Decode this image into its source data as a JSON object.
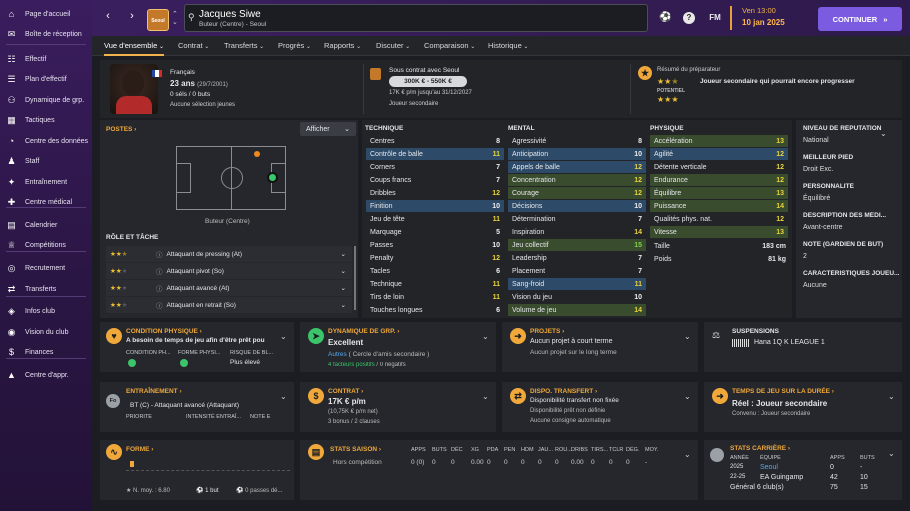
{
  "sidebar": {
    "items": [
      {
        "label": "Page d'accueil",
        "icon": "home-icon",
        "glyph": "⌂"
      },
      {
        "label": "Boîte de réception",
        "icon": "inbox-icon",
        "glyph": "✉"
      },
      {
        "label": "Effectif",
        "icon": "squad-icon",
        "glyph": "☷"
      },
      {
        "label": "Plan d'effectif",
        "icon": "squad-plan-icon",
        "glyph": "☰"
      },
      {
        "label": "Dynamique de grp.",
        "icon": "dynamics-icon",
        "glyph": "⚇"
      },
      {
        "label": "Tactiques",
        "icon": "tactics-icon",
        "glyph": "▦"
      },
      {
        "label": "Centre des données",
        "icon": "data-hub-icon",
        "glyph": "◔"
      },
      {
        "label": "Staff",
        "icon": "staff-icon",
        "glyph": "♟"
      },
      {
        "label": "Entraînement",
        "icon": "training-icon",
        "glyph": "✦"
      },
      {
        "label": "Centre médical",
        "icon": "medical-icon",
        "glyph": "✚"
      },
      {
        "label": "Calendrier",
        "icon": "calendar-icon",
        "glyph": "▤"
      },
      {
        "label": "Compétitions",
        "icon": "trophy-icon",
        "glyph": "♕"
      },
      {
        "label": "Recrutement",
        "icon": "scouting-icon",
        "glyph": "◎"
      },
      {
        "label": "Transferts",
        "icon": "transfers-icon",
        "glyph": "⇄"
      },
      {
        "label": "Infos club",
        "icon": "club-info-icon",
        "glyph": "◈"
      },
      {
        "label": "Vision du club",
        "icon": "club-vision-icon",
        "glyph": "◉"
      },
      {
        "label": "Finances",
        "icon": "finances-icon",
        "glyph": "$"
      },
      {
        "label": "Centre d'appr.",
        "icon": "dev-centre-icon",
        "glyph": "▲"
      }
    ]
  },
  "header": {
    "club_badge_text": "Seoul",
    "player_name": "Jacques Siwe",
    "player_sub": "Buteur (Centre) - Seoul",
    "fm_label": "FM",
    "time": "Ven 13:00",
    "date": "10 jan 2025",
    "continue_label": "CONTINUER"
  },
  "tabs": [
    "Vue d'ensemble",
    "Contrat",
    "Transferts",
    "Progrès",
    "Rapports",
    "Discuter",
    "Comparaison",
    "Historique"
  ],
  "profile": {
    "nationality": "Français",
    "age": "23 ans",
    "birth": "(29/7/2001)",
    "caps": "0 séls / 0 buts",
    "youth": "Aucune sélection jeunes",
    "contract_title": "Sous contrat avec Seoul",
    "value": "300K € - 550K €",
    "wage": "17K € p/m jusqu'au 31/12/2027",
    "squad_status": "Joueur secondaire",
    "coach_title": "Résumé du préparateur",
    "coach_summary": "Joueur secondaire qui pourrait encore progresser",
    "potential_label": "POTENTIEL"
  },
  "positions": {
    "title": "POSTES",
    "show_label": "Afficher",
    "position_name": "Buteur (Centre)",
    "role_title": "RÔLE ET TÂCHE",
    "roles": [
      {
        "name": "Attaquant de pressing (At)",
        "stars": 2.5
      },
      {
        "name": "Attaquant pivot (So)",
        "stars": 2
      },
      {
        "name": "Attaquant avancé (At)",
        "stars": 2
      },
      {
        "name": "Attaquant en retrait (So)",
        "stars": 2
      }
    ]
  },
  "attributes": {
    "technique_title": "TECHNIQUE",
    "mental_title": "MENTAL",
    "physique_title": "PHYSIQUE",
    "technique": [
      {
        "name": "Centres",
        "value": "8",
        "hl": "",
        "color": "w"
      },
      {
        "name": "Contrôle de balle",
        "value": "11",
        "hl": "blue",
        "color": "y"
      },
      {
        "name": "Corners",
        "value": "7",
        "hl": "",
        "color": "w"
      },
      {
        "name": "Coups francs",
        "value": "7",
        "hl": "",
        "color": "w"
      },
      {
        "name": "Dribbles",
        "value": "12",
        "hl": "",
        "color": "y"
      },
      {
        "name": "Finition",
        "value": "10",
        "hl": "blue",
        "color": "w"
      },
      {
        "name": "Jeu de tête",
        "value": "11",
        "hl": "",
        "color": "y"
      },
      {
        "name": "Marquage",
        "value": "5",
        "hl": "",
        "color": "w"
      },
      {
        "name": "Passes",
        "value": "10",
        "hl": "",
        "color": "w"
      },
      {
        "name": "Penalty",
        "value": "12",
        "hl": "",
        "color": "y"
      },
      {
        "name": "Tacles",
        "value": "6",
        "hl": "",
        "color": "w"
      },
      {
        "name": "Technique",
        "value": "11",
        "hl": "",
        "color": "y"
      },
      {
        "name": "Tirs de loin",
        "value": "11",
        "hl": "",
        "color": "y"
      },
      {
        "name": "Touches longues",
        "value": "6",
        "hl": "",
        "color": "w"
      }
    ],
    "mental": [
      {
        "name": "Agressivité",
        "value": "8",
        "hl": "",
        "color": "w"
      },
      {
        "name": "Anticipation",
        "value": "10",
        "hl": "blue",
        "color": "w"
      },
      {
        "name": "Appels de balle",
        "value": "12",
        "hl": "blue",
        "color": "y"
      },
      {
        "name": "Concentration",
        "value": "12",
        "hl": "green",
        "color": "y"
      },
      {
        "name": "Courage",
        "value": "12",
        "hl": "green",
        "color": "y"
      },
      {
        "name": "Décisions",
        "value": "10",
        "hl": "blue",
        "color": "w"
      },
      {
        "name": "Détermination",
        "value": "7",
        "hl": "",
        "color": "w"
      },
      {
        "name": "Inspiration",
        "value": "14",
        "hl": "",
        "color": "y"
      },
      {
        "name": "Jeu collectif",
        "value": "15",
        "hl": "green",
        "color": "g"
      },
      {
        "name": "Leadership",
        "value": "7",
        "hl": "",
        "color": "w"
      },
      {
        "name": "Placement",
        "value": "7",
        "hl": "",
        "color": "w"
      },
      {
        "name": "Sang-froid",
        "value": "11",
        "hl": "blue",
        "color": "y"
      },
      {
        "name": "Vision du jeu",
        "value": "10",
        "hl": "",
        "color": "w"
      },
      {
        "name": "Volume de jeu",
        "value": "14",
        "hl": "green",
        "color": "y"
      }
    ],
    "physique": [
      {
        "name": "Accélération",
        "value": "13",
        "hl": "green",
        "color": "y"
      },
      {
        "name": "Agilité",
        "value": "12",
        "hl": "blue",
        "color": "y"
      },
      {
        "name": "Détente verticale",
        "value": "12",
        "hl": "",
        "color": "y"
      },
      {
        "name": "Endurance",
        "value": "12",
        "hl": "green",
        "color": "y"
      },
      {
        "name": "Équilibre",
        "value": "13",
        "hl": "green",
        "color": "y"
      },
      {
        "name": "Puissance",
        "value": "14",
        "hl": "green",
        "color": "y"
      },
      {
        "name": "Qualités phys. nat.",
        "value": "12",
        "hl": "",
        "color": "y"
      },
      {
        "name": "Vitesse",
        "value": "13",
        "hl": "green",
        "color": "y"
      }
    ],
    "height_label": "Taille",
    "height": "183 cm",
    "weight_label": "Poids",
    "weight": "81 kg"
  },
  "info_panel": [
    {
      "title": "NIVEAU DE RÉPUTATION",
      "value": "National"
    },
    {
      "title": "MEILLEUR PIED",
      "value": "Droit Exc."
    },
    {
      "title": "PERSONNALITÉ",
      "value": "Équilibré"
    },
    {
      "title": "DESCRIPTION DES MÉDI...",
      "value": "Avant-centre"
    },
    {
      "title": "NOTE (GARDIEN DE BUT)",
      "value": "2"
    },
    {
      "title": "CARACTÉRISTIQUES JOUEU...",
      "value": "Aucune"
    }
  ],
  "cards": {
    "condition": {
      "title": "CONDITION PHYSIQUE",
      "line1": "A besoin de temps de jeu afin d'être prêt pou",
      "h1": "CONDITION PH...",
      "h2": "FORME PHYSI...",
      "h3": "RISQUE DE BL...",
      "v3": "Plus élevé"
    },
    "dynamics": {
      "title": "DYNAMIQUE DE GRP.",
      "line1": "Excellent",
      "line2": "Autres",
      "line2b": "( Cercle d'amis secondaire )",
      "line3": "4 facteurs positifs",
      "line3b": "/ 0 négatifs"
    },
    "projects": {
      "title": "PROJETS",
      "line1": "Aucun projet à court terme",
      "line2": "Aucun projet sur le long terme"
    },
    "suspensions": {
      "title": "SUSPENSIONS",
      "line1": "Hana 1Q K LEAGUE 1"
    },
    "training": {
      "title": "ENTRAÎNEMENT",
      "badge": "Fo",
      "line1": "BT (C) - Attaquant avancé (Attaquant)",
      "h1": "PRIORITE",
      "h2": "INTENSITÉ ENTRAÎ...",
      "h3": "NOTE E"
    },
    "contract": {
      "title": "CONTRAT",
      "line1": "17K € p/m",
      "line2": "(10,75K € p/m net)",
      "line3": "3 bonus / 2 clauses"
    },
    "transfer": {
      "title": "DISPO. TRANSFERT",
      "line1": "Disponibilité transfert non fixée",
      "line2": "Disponibilité prêt non définie",
      "line3": "Aucune consigne automatique"
    },
    "playtime": {
      "title": "TEMPS DE JEU SUR LA DURÉE",
      "line1": "Réel : Joueur secondaire",
      "line2": "Convenu : Joueur secondaire"
    },
    "form": {
      "title": "FORME",
      "avg": "N. moy. : 6.80",
      "goals": "1 but",
      "passes": "0 passes dé..."
    },
    "stats": {
      "title": "STATS SAISON",
      "row_label": "Hors compétition",
      "headers": [
        "APPS",
        "BUTS",
        "DÉC",
        "XG",
        "PDA",
        "PEN",
        "HDM",
        "JAU...",
        "ROU...",
        "DRIBS",
        "TIRS...",
        "TCLR",
        "DÉG.",
        "MOY."
      ],
      "values": [
        "0 (0)",
        "0",
        "0",
        "0.00",
        "0",
        "0",
        "0",
        "0",
        "0",
        "0.00",
        "0",
        "0",
        "0",
        "-"
      ]
    },
    "career": {
      "title": "STATS CARRIÈRE",
      "h_year": "ANNÉE",
      "h_team": "ÉQUIPE",
      "h_apps": "APPS",
      "h_goals": "BUTS",
      "rows": [
        {
          "year": "2025",
          "team": "Seoul",
          "apps": "0",
          "goals": "-"
        },
        {
          "year": "22-25",
          "team": "EA Guingamp",
          "apps": "42",
          "goals": "10"
        },
        {
          "year": "",
          "team": "Général 6 club(s)",
          "apps": "75",
          "goals": "15"
        }
      ]
    }
  },
  "colors": {
    "accent": "#f0a83a",
    "continue": "#7b5ce0",
    "sidebar": "#2f1a4d"
  }
}
